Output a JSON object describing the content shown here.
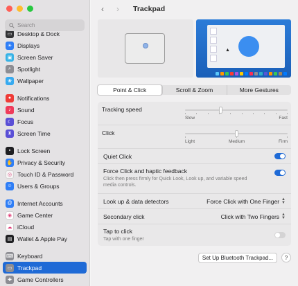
{
  "window": {
    "title": "Trackpad",
    "traffic_lights": {
      "close": "#ff5f57",
      "minimize": "#febc2e",
      "zoom": "#28c840"
    }
  },
  "search": {
    "placeholder": "Search"
  },
  "sidebar": {
    "items": [
      {
        "label": "Desktop & Dock",
        "icon": "dock-icon",
        "color": "#333336"
      },
      {
        "label": "Displays",
        "icon": "display-icon",
        "color": "#2f7ef6"
      },
      {
        "label": "Screen Saver",
        "icon": "screensaver-icon",
        "color": "#38b3e6"
      },
      {
        "label": "Spotlight",
        "icon": "magnifier-icon",
        "color": "#8d8d93"
      },
      {
        "label": "Wallpaper",
        "icon": "wallpaper-icon",
        "color": "#37aaf0"
      },
      {
        "label": "Notifications",
        "icon": "bell-icon",
        "color": "#ef3b37"
      },
      {
        "label": "Sound",
        "icon": "speaker-icon",
        "color": "#ef3b5b"
      },
      {
        "label": "Focus",
        "icon": "moon-icon",
        "color": "#5a4fd6"
      },
      {
        "label": "Screen Time",
        "icon": "hourglass-icon",
        "color": "#5a4fd6"
      },
      {
        "label": "Lock Screen",
        "icon": "lock-icon",
        "color": "#1f1f22"
      },
      {
        "label": "Privacy & Security",
        "icon": "hand-icon",
        "color": "#2f7ef6"
      },
      {
        "label": "Touch ID & Password",
        "icon": "fingerprint-icon",
        "color": "#f5f5f5"
      },
      {
        "label": "Users & Groups",
        "icon": "users-icon",
        "color": "#2f7ef6"
      },
      {
        "label": "Internet Accounts",
        "icon": "at-icon",
        "color": "#2f7ef6"
      },
      {
        "label": "Game Center",
        "icon": "gamecenter-icon",
        "color": "#ffffff"
      },
      {
        "label": "iCloud",
        "icon": "cloud-icon",
        "color": "#ffffff"
      },
      {
        "label": "Wallet & Apple Pay",
        "icon": "wallet-icon",
        "color": "#1f1f22"
      },
      {
        "label": "Keyboard",
        "icon": "keyboard-icon",
        "color": "#8d8d93"
      },
      {
        "label": "Trackpad",
        "icon": "trackpad-icon",
        "color": "#8d8d93"
      },
      {
        "label": "Game Controllers",
        "icon": "gamepad-icon",
        "color": "#8d8d93"
      }
    ],
    "selected": "Trackpad"
  },
  "tabs": [
    {
      "label": "Point & Click",
      "active": true
    },
    {
      "label": "Scroll & Zoom",
      "active": false
    },
    {
      "label": "More Gestures",
      "active": false
    }
  ],
  "settings": {
    "tracking_speed": {
      "label": "Tracking speed",
      "min_label": "Slow",
      "max_label": "Fast",
      "value": 0.34
    },
    "click": {
      "label": "Click",
      "labels": [
        "Light",
        "Medium",
        "Firm"
      ],
      "value": 0.5
    },
    "quiet_click": {
      "label": "Quiet Click",
      "on": true
    },
    "force_click": {
      "label": "Force Click and haptic feedback",
      "sub": "Click then press firmly for Quick Look, Look up, and variable speed media controls.",
      "on": true
    },
    "lookup": {
      "label": "Look up & data detectors",
      "value": "Force Click with One Finger"
    },
    "secondary_click": {
      "label": "Secondary click",
      "value": "Click with Two Fingers"
    },
    "tap_to_click": {
      "label": "Tap to click",
      "sub": "Tap with one finger",
      "on": false
    }
  },
  "buttons": {
    "bluetooth": "Set Up Bluetooth Trackpad...",
    "help": "?"
  },
  "colors": {
    "accent": "#1f6ad6"
  }
}
